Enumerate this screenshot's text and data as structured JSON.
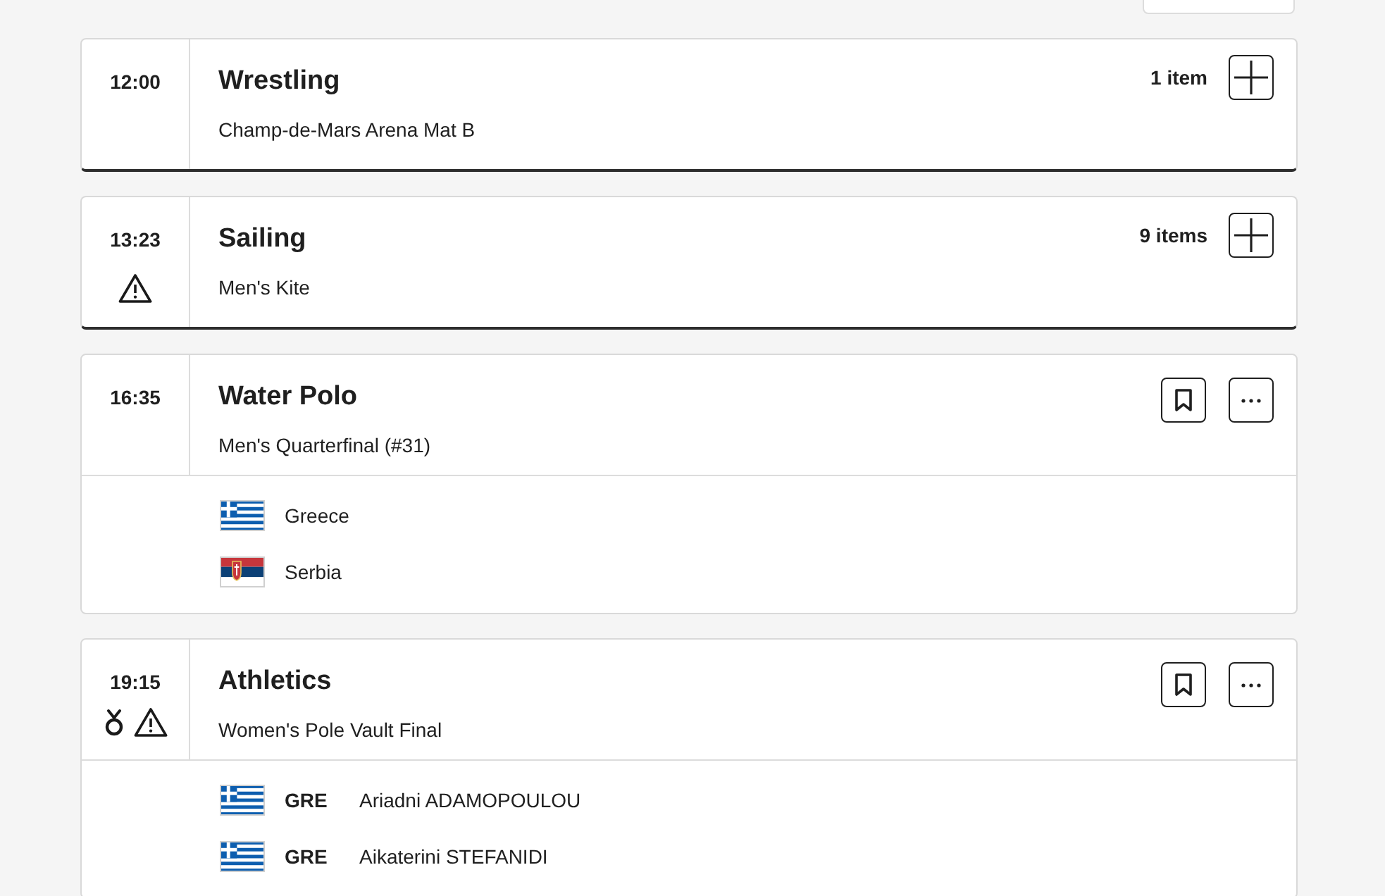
{
  "events": [
    {
      "kind": "collapsed",
      "time": "12:00",
      "medal": false,
      "warning": false,
      "sport": "Wrestling",
      "detail": "Champ-de-Mars Arena Mat B",
      "count": "1 item"
    },
    {
      "kind": "collapsed",
      "time": "13:23",
      "medal": false,
      "warning": true,
      "sport": "Sailing",
      "detail": "Men's Kite",
      "count": "9 items"
    },
    {
      "kind": "event",
      "time": "16:35",
      "medal": false,
      "warning": false,
      "sport": "Water Polo",
      "detail": "Men's Quarterfinal (#31)",
      "participants": [
        {
          "kind": "team",
          "flag": {
            "kind": "greece"
          },
          "name": "Greece"
        },
        {
          "kind": "team",
          "flag": {
            "kind": "serbia"
          },
          "name": "Serbia"
        }
      ]
    },
    {
      "kind": "event",
      "time": "19:15",
      "medal": true,
      "warning": true,
      "sport": "Athletics",
      "detail": "Women's Pole Vault Final",
      "participants": [
        {
          "kind": "athlete",
          "flag": {
            "kind": "greece"
          },
          "code": "GRE",
          "name": "Ariadni ADAMOPOULOU"
        },
        {
          "kind": "athlete",
          "flag": {
            "kind": "greece"
          },
          "code": "GRE",
          "name": "Aikaterini STEFANIDI"
        }
      ]
    }
  ]
}
